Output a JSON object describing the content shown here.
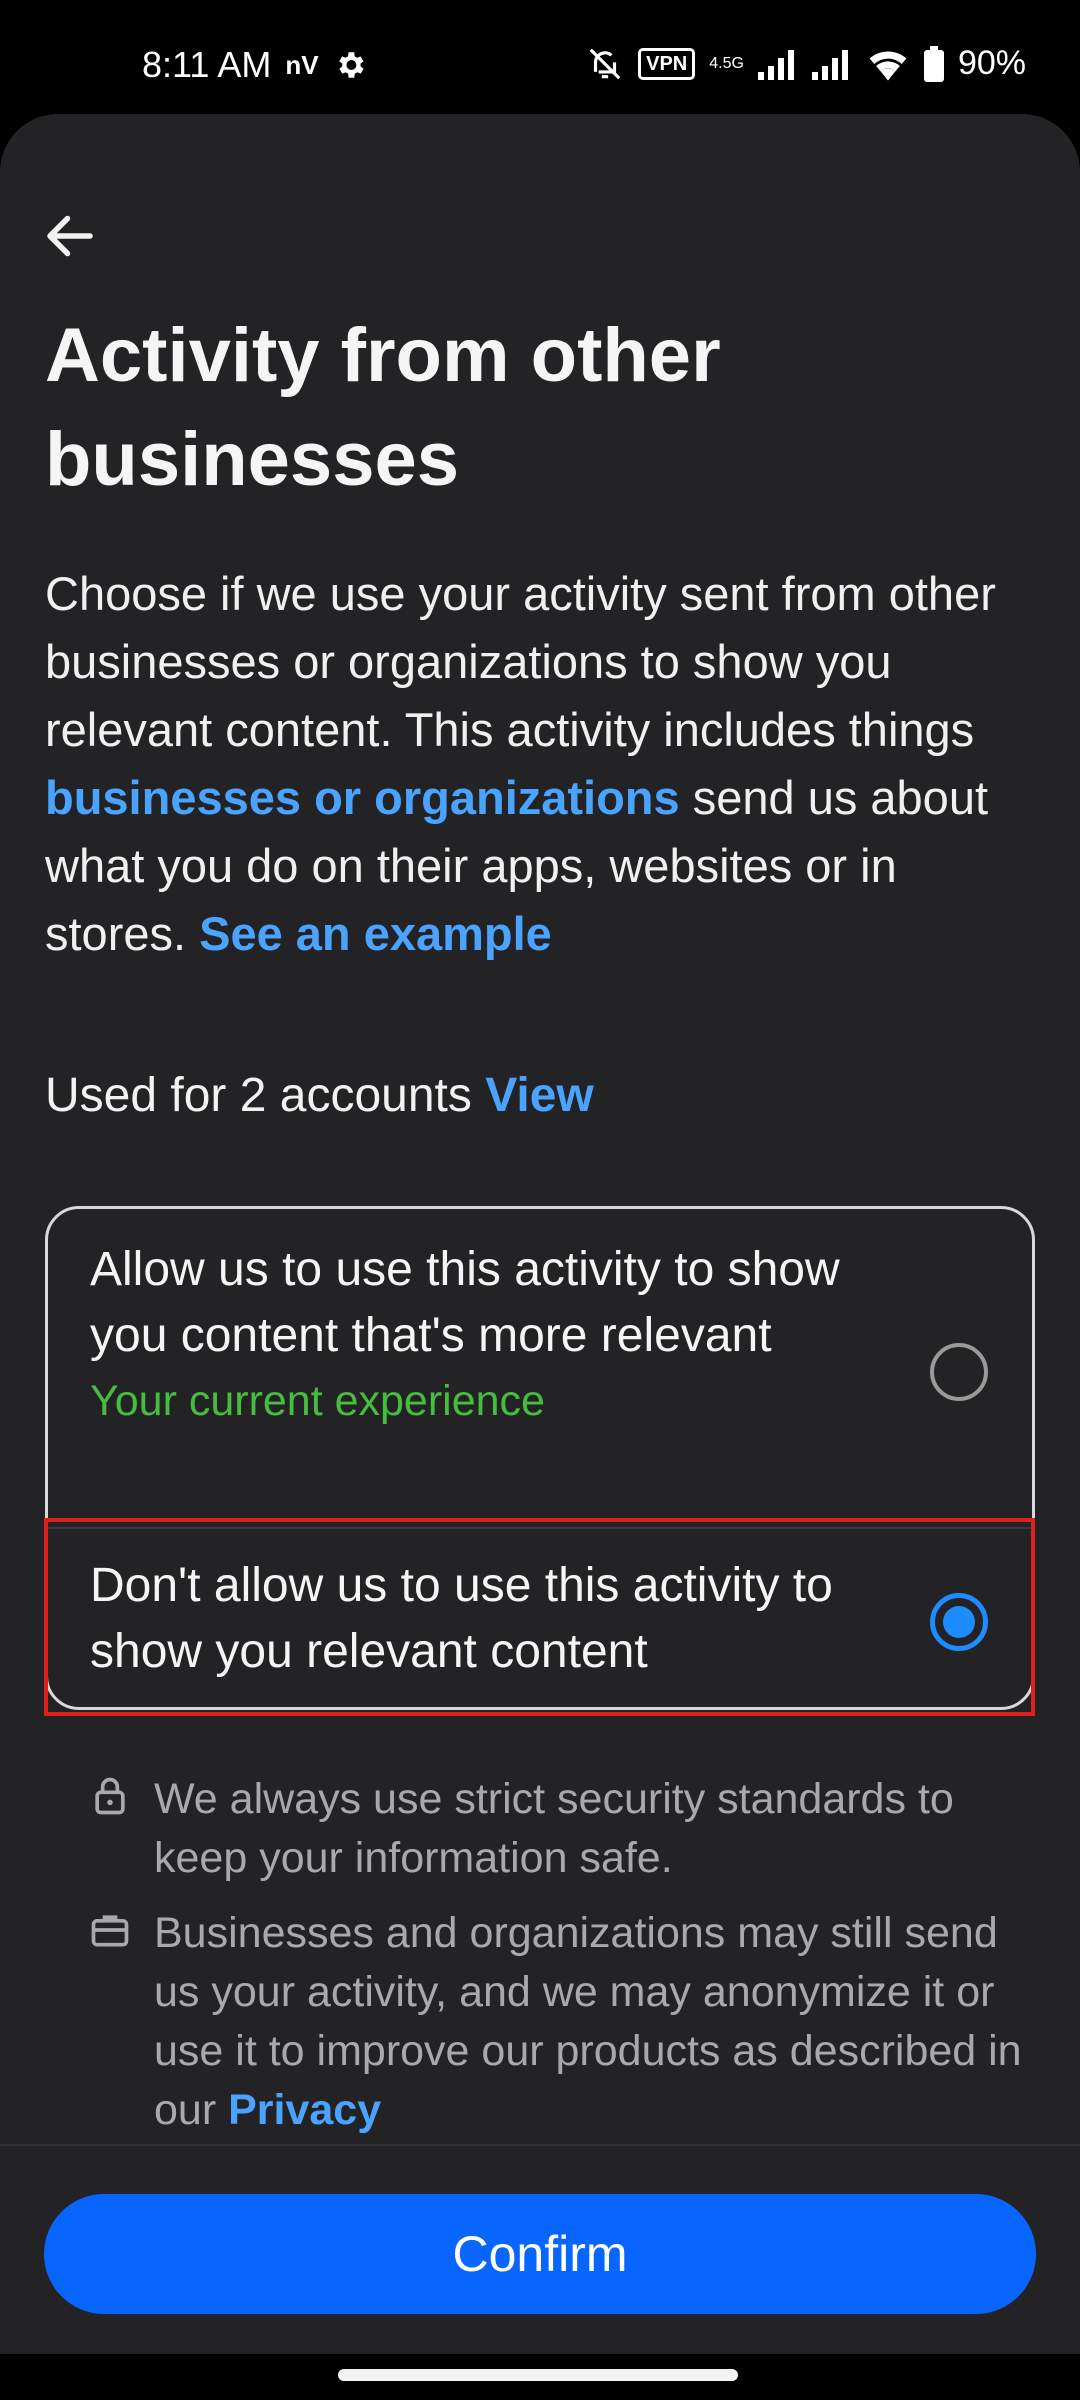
{
  "status_bar": {
    "time": "8:11 AM",
    "carrier_mark": "nV",
    "vpn_label": "VPN",
    "network_label": "4.5G",
    "battery": "90%"
  },
  "header": {
    "back_icon": "arrow-left-icon",
    "title": "Activity from other businesses"
  },
  "description": {
    "part1": "Choose if we use your activity sent from other businesses or organizations to show you relevant content. This activity includes things ",
    "link1": "businesses or organizations",
    "part2": " send us about what you do on their apps, websites or in stores. ",
    "link2": "See an example"
  },
  "accounts": {
    "text": "Used for 2 accounts ",
    "link": "View"
  },
  "options": [
    {
      "label": "Allow us to use this activity to show you content that's more relevant",
      "sublabel": "Your current experience",
      "selected": false
    },
    {
      "label": "Don't allow us to use this activity to show you relevant content",
      "selected": true
    }
  ],
  "info": [
    {
      "icon": "lock-icon",
      "text": "We always use strict security standards to keep your information safe."
    },
    {
      "icon": "briefcase-icon",
      "text": "Businesses and organizations may still send us your activity, and we may anonymize it or use it to improve our products as described in our ",
      "link": "Privacy"
    }
  ],
  "footer": {
    "confirm_label": "Confirm"
  },
  "colors": {
    "accent": "#0866ff",
    "link": "#4aa3ff",
    "success": "#45bd3e",
    "highlight": "#e0201f"
  }
}
